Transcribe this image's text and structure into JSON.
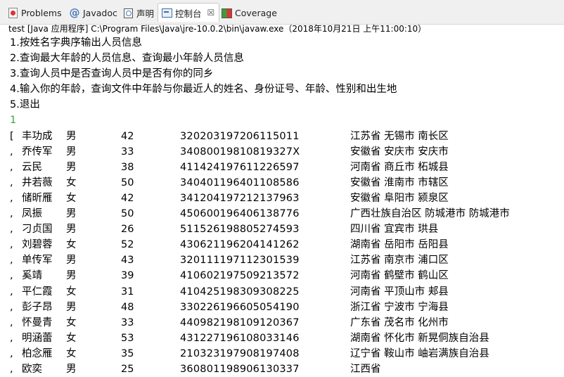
{
  "tabs": [
    {
      "label": "Problems",
      "icon": "problems-icon",
      "active": false
    },
    {
      "label": "Javadoc",
      "icon": "javadoc-icon",
      "active": false
    },
    {
      "label": "声明",
      "icon": "declaration-icon",
      "active": false
    },
    {
      "label": "控制台",
      "icon": "console-icon",
      "active": true,
      "close": "☒"
    },
    {
      "label": "Coverage",
      "icon": "coverage-icon",
      "active": false
    }
  ],
  "console_description": "test [Java 应用程序] C:\\Program Files\\Java\\jre-10.0.2\\bin\\javaw.exe（2018年10月21日 上午11:00:10）",
  "menu": [
    "1.按姓名字典序输出人员信息",
    "2.查询最大年龄的人员信息、查询最小年龄人员信息",
    "3.查询人员中是否查询人员中是否有你的同乡",
    "4.输入你的年龄，查询文件中年龄与你最近人的姓名、身份证号、年龄、性别和出生地",
    "5.退出"
  ],
  "user_input": "1",
  "people": [
    {
      "prefix": "[",
      "name": "丰功成",
      "sex": "男",
      "age": "42",
      "id": "320203197206115011",
      "addr": "江苏省 无锡市 南长区"
    },
    {
      "prefix": ",",
      "name": "乔传军",
      "sex": "男",
      "age": "33",
      "id": "34080019810819327X",
      "addr": "安徽省 安庆市 安庆市"
    },
    {
      "prefix": ",",
      "name": "云民",
      "sex": "男",
      "age": "38",
      "id": "411424197611226597",
      "addr": "河南省 商丘市 柘城县"
    },
    {
      "prefix": ",",
      "name": "井若薇",
      "sex": "女",
      "age": "50",
      "id": "340401196401108586",
      "addr": "安徽省 淮南市 市辖区"
    },
    {
      "prefix": ",",
      "name": "储昕雁",
      "sex": "女",
      "age": "42",
      "id": "341204197212137963",
      "addr": "安徽省 阜阳市 颍泉区"
    },
    {
      "prefix": ",",
      "name": "凤振",
      "sex": "男",
      "age": "50",
      "id": "450600196406138776",
      "addr": "广西壮族自治区 防城港市 防城港市"
    },
    {
      "prefix": ",",
      "name": "刁贞国",
      "sex": "男",
      "age": "26",
      "id": "511526198805274593",
      "addr": "四川省 宜宾市 珙县"
    },
    {
      "prefix": ",",
      "name": "刘碧蓉",
      "sex": "女",
      "age": "52",
      "id": "430621196204141262",
      "addr": "湖南省 岳阳市 岳阳县"
    },
    {
      "prefix": ",",
      "name": "单传军",
      "sex": "男",
      "age": "43",
      "id": "320111197112301539",
      "addr": "江苏省 南京市 浦口区"
    },
    {
      "prefix": ",",
      "name": "奚靖",
      "sex": "男",
      "age": "39",
      "id": "410602197509213572",
      "addr": "河南省 鹤壁市 鹤山区"
    },
    {
      "prefix": ",",
      "name": "平仁霞",
      "sex": "女",
      "age": "31",
      "id": "410425198309308225",
      "addr": "河南省 平顶山市 郏县"
    },
    {
      "prefix": ",",
      "name": "彭子昂",
      "sex": "男",
      "age": "48",
      "id": "330226196605054190",
      "addr": "浙江省 宁波市 宁海县"
    },
    {
      "prefix": ",",
      "name": "怀曼青",
      "sex": "女",
      "age": "33",
      "id": "440982198109120367",
      "addr": "广东省 茂名市 化州市"
    },
    {
      "prefix": ",",
      "name": "明涵蕾",
      "sex": "女",
      "age": "53",
      "id": "431227196108033146",
      "addr": "湖南省 怀化市 新晃侗族自治县"
    },
    {
      "prefix": ",",
      "name": "柏念雁",
      "sex": "女",
      "age": "35",
      "id": "210323197908197408",
      "addr": "辽宁省 鞍山市 岫岩满族自治县"
    },
    {
      "prefix": ",",
      "name": "欧奕",
      "sex": "男",
      "age": "25",
      "id": "360801198906130337",
      "addr": "江西省"
    }
  ]
}
